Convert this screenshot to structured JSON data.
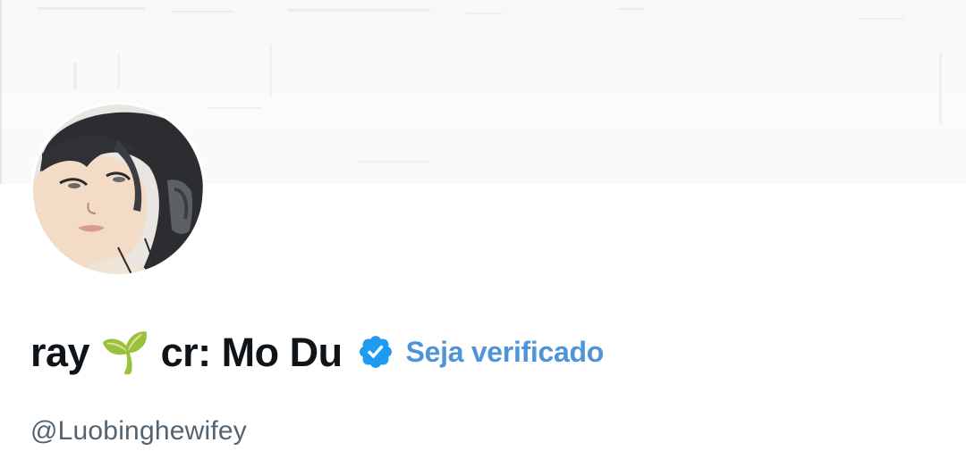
{
  "profile": {
    "display_name": "ray 🌱 cr: Mo Du",
    "get_verified_label": "Seja verificado",
    "handle": "@Luobinghewifey"
  },
  "icons": {
    "verified": "verified-badge-icon"
  },
  "colors": {
    "name_text": "#0f1419",
    "handle_text": "#536471",
    "verified_badge": "#1d9bf0",
    "get_verified_link": "#4f94d9",
    "banner": "#f8f8f8"
  }
}
